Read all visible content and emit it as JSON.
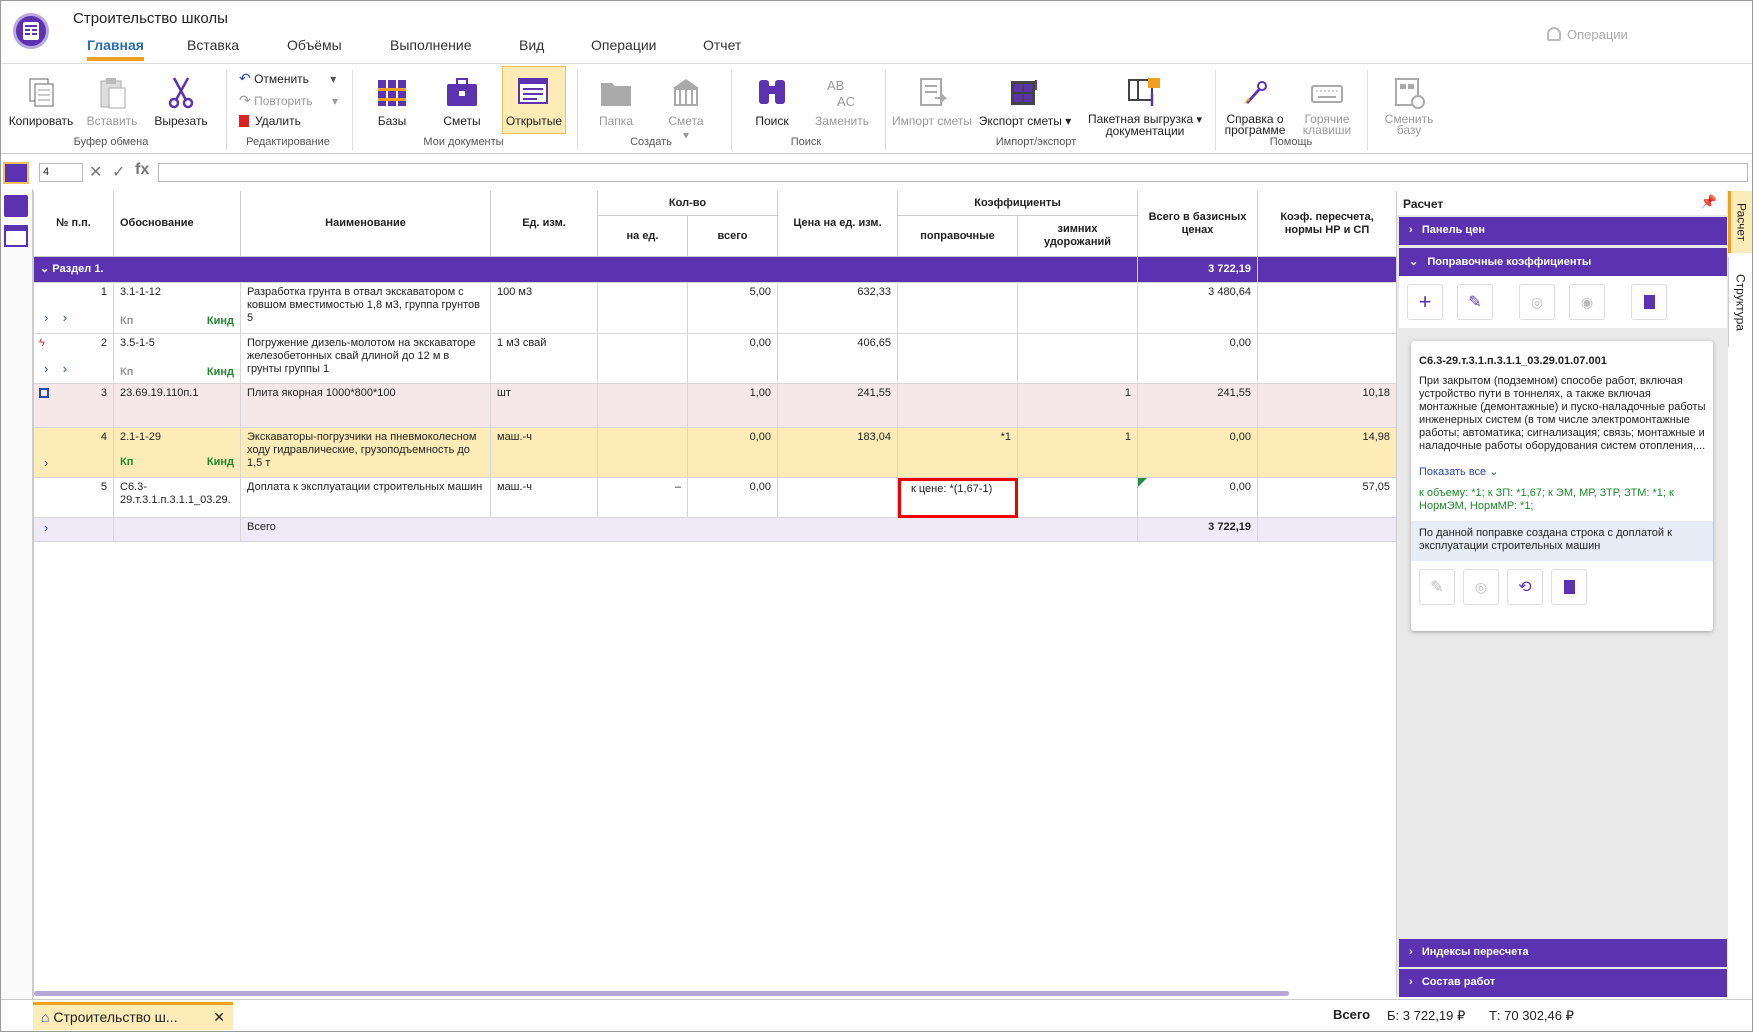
{
  "app": {
    "title": "Строительство школы",
    "ops_label": "Операции"
  },
  "tabs": [
    {
      "label": "Главная"
    },
    {
      "label": "Вставка"
    },
    {
      "label": "Объёмы"
    },
    {
      "label": "Выполнение"
    },
    {
      "label": "Вид"
    },
    {
      "label": "Операции"
    },
    {
      "label": "Отчет"
    }
  ],
  "ribbon": {
    "copy": "Копировать",
    "paste": "Вставить",
    "cut": "Вырезать",
    "clipboard_group": "Буфер обмена",
    "undo": "Отменить",
    "redo": "Повторить",
    "delete": "Удалить",
    "edit_group": "Редактирование",
    "bases": "Базы",
    "estimates": "Сметы",
    "open": "Открытые",
    "mydocs_group": "Мои документы",
    "folder": "Папка",
    "estimate": "Смета",
    "create_group": "Создать",
    "search": "Поиск",
    "replace": "Заменить",
    "search_group": "Поиск",
    "import": "Импорт сметы",
    "export": "Экспорт сметы",
    "batch1": "Пакетная выгрузка",
    "batch2": "документации",
    "io_group": "Импорт/экспорт",
    "help1": "Справка о",
    "help2": "программе",
    "hot1": "Горячие",
    "hot2": "клавиши",
    "help_group": "Помощь",
    "chg1": "Сменить",
    "chg2": "базу"
  },
  "formula": {
    "cell": "4",
    "value": ""
  },
  "grid": {
    "headers": {
      "num": "№ п.п.",
      "basis": "Обоснование",
      "name": "Наименование",
      "unit": "Ед. изм.",
      "qty": "Кол-во",
      "qty_unit": "на ед.",
      "qty_total": "всего",
      "price": "Цена на ед. изм.",
      "coef": "Коэффициенты",
      "coef_corr": "поправочные",
      "coef_winter": "зимних удорожаний",
      "total": "Всего в базисных ценах",
      "recalc": "Коэф. пересчета, нормы НР и СП"
    },
    "section": {
      "label": "Раздел 1.",
      "total": "3 722,19"
    },
    "rows": [
      {
        "num": "1",
        "basis": "3.1-1-12",
        "name": "Разработка грунта в отвал экскаватором с ковшом вместимостью 1,8 м3, группа грунтов 5",
        "unit": "100 м3",
        "qty_unit": "",
        "qty_total": "5,00",
        "price": "632,33",
        "corr": "",
        "winter": "",
        "total": "3 480,64",
        "recalc": "",
        "kp": "Кп",
        "kind": "Кинд"
      },
      {
        "num": "2",
        "basis": "3.5-1-5",
        "name": "Погружение дизель-молотом на экскаваторе железобетонных свай длиной до 12 м в грунты группы 1",
        "unit": "1 м3 свай",
        "qty_unit": "",
        "qty_total": "0,00",
        "price": "406,65",
        "corr": "",
        "winter": "",
        "total": "0,00",
        "recalc": "",
        "kp": "Кп",
        "kind": "Кинд"
      },
      {
        "num": "3",
        "basis": "23.69.19.110п.1",
        "name": "Плита якорная 1000*800*100",
        "unit": "шт",
        "qty_unit": "",
        "qty_total": "1,00",
        "price": "241,55",
        "corr": "",
        "winter": "1",
        "total": "241,55",
        "recalc": "10,18"
      },
      {
        "num": "4",
        "basis": "2.1-1-29",
        "name": "Экскаваторы-погрузчики на пневмоколесном ходу гидравлические, грузоподъемность до 1,5 т",
        "unit": "маш.-ч",
        "qty_unit": "",
        "qty_total": "0,00",
        "price": "183,04",
        "corr": "*1",
        "winter": "1",
        "total": "0,00",
        "recalc": "14,98",
        "kp": "Кп",
        "kind": "Кинд"
      },
      {
        "num": "5",
        "basis": "С6.3-29.т.3.1.п.3.1.1_03.29.",
        "name": "Доплата к эксплуатации строительных машин",
        "unit": "маш.-ч",
        "qty_unit": "–",
        "qty_total": "0,00",
        "price": "",
        "corr": "к цене: *(1,67-1)",
        "winter": "",
        "total": "0,00",
        "recalc": "57,05"
      }
    ],
    "total_row": {
      "label": "Всего",
      "total": "3 722,19"
    }
  },
  "panel": {
    "title": "Расчет",
    "price_panel": "Панель цен",
    "corr_coefs": "Поправочные коэффициенты",
    "card_code": "С6.3-29.т.3.1.п.3.1.1_03.29.01.07.001",
    "card_desc": "При закрытом (подземном) способе работ, включая устройство пути в тоннелях, а также включая монтажные (демонтажные) и пуско-наладочные работы инженерных систем (в том числе электромонтажные работы; автоматика; сигнализация; связь; монтажные и наладочные работы оборудования систем отопления,...",
    "show_all": "Показать все",
    "card_green": "к объему: *1; к ЗП: *1,67; к ЭМ, МР, ЗТР, ЗТМ: *1; к НормЭМ, НормМР: *1;",
    "card_note": "По данной поправке создана строка с доплатой к эксплуатации строительных машин",
    "indexes": "Индексы пересчета",
    "works": "Состав работ"
  },
  "sidetabs": {
    "calc": "Расчет",
    "struct": "Структура"
  },
  "status": {
    "doc_tab": "Строительство ш...",
    "total_label": "Всего",
    "b": "Б: 3 722,19 ₽",
    "t": "Т: 70 302,46 ₽"
  }
}
